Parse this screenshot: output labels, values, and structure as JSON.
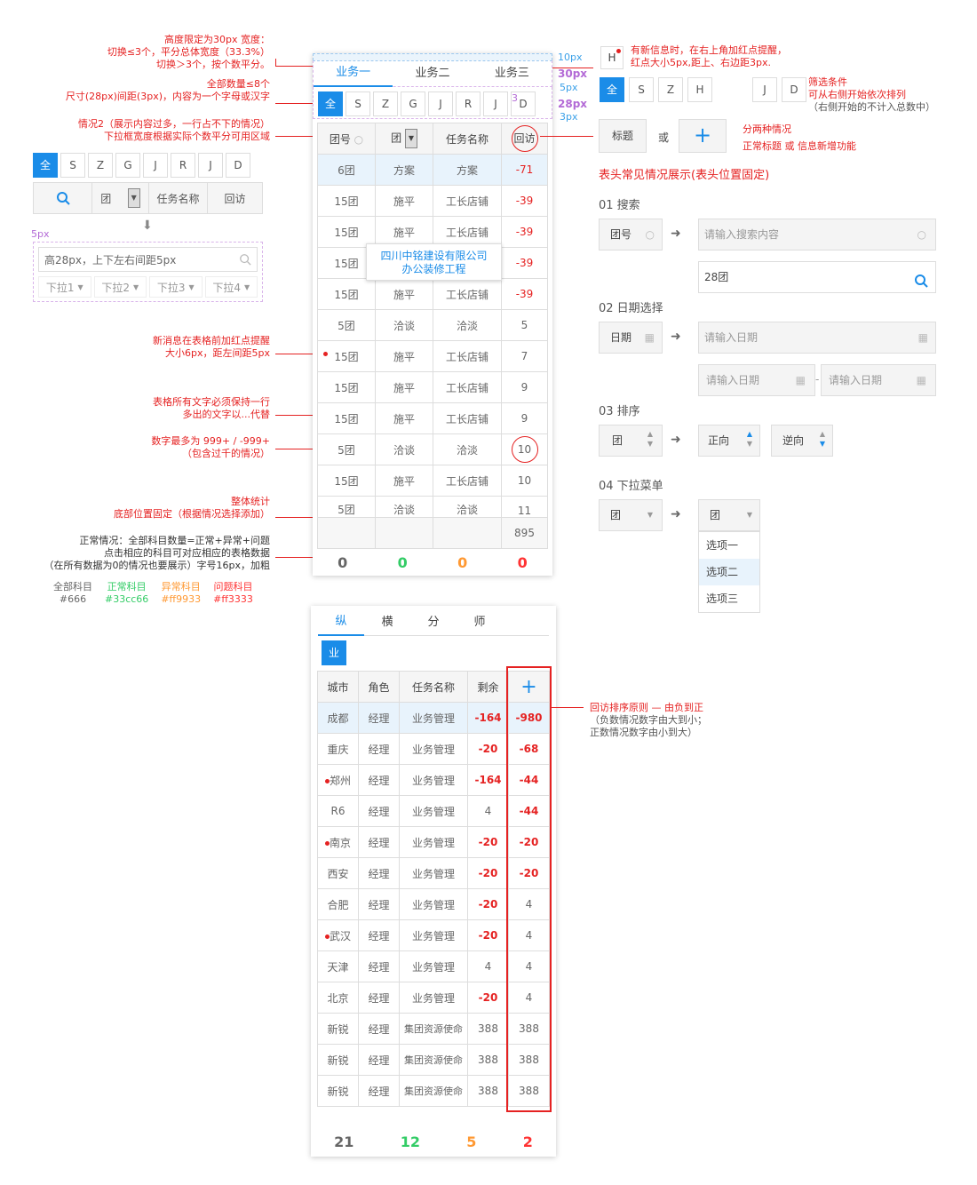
{
  "notes": {
    "n1": [
      "高度限定为30px 宽度：",
      "切换≤3个，平分总体宽度（33.3%）",
      "切换＞3个，按个数平分。"
    ],
    "n2": [
      "全部数量≤8个",
      "尺寸(28px)间距(3px)，内容为一个字母或汉字"
    ],
    "n3": [
      "情况2（展示内容过多，一行占不下的情况）",
      "下拉框宽度根据实际个数平分可用区域"
    ],
    "n4": [
      "新消息在表格前加红点提醒",
      "大小6px，距左间距5px"
    ],
    "n5": [
      "表格所有文字必须保持一行",
      "多出的文字以...代替"
    ],
    "n6": [
      "数字最多为 999+ / -999+",
      "（包含过千的情况）"
    ],
    "n7": [
      "整体统计",
      "底部位置固定（根据情况选择添加）"
    ],
    "n8": [
      "正常情况：全部科目数量=正常+异常+问题",
      "点击相应的科目可对应相应的表格数据",
      "（在所有数据为0的情况也要展示）字号16px，加粗"
    ],
    "legend": [
      {
        "label": "全部科目",
        "hex": "#666"
      },
      {
        "label": "正常科目",
        "hex": "#33cc66"
      },
      {
        "label": "异常科目",
        "hex": "#ff9933"
      },
      {
        "label": "问题科目",
        "hex": "#ff3333"
      }
    ],
    "r1": [
      "有新信息时，在右上角加红点提醒，",
      "红点大小5px,距上、右边距3px."
    ],
    "r2": [
      "筛选条件",
      "可从右侧开始依次排列",
      "（右侧开始的不计入总数中）"
    ],
    "r3": [
      "分两种情况",
      "正常标题 或 信息新增功能"
    ],
    "r4": [
      "回访排序原则 — 由负到正",
      "（负数情况数字由大到小；",
      "正数情况数字由小到大）"
    ],
    "headtitle": "表头常见情况展示(表头位置固定)"
  },
  "dims": {
    "d10": "10px",
    "d30": "30px",
    "d5": "5px",
    "d3a": "3",
    "d28": "28px",
    "d3": "3px",
    "d5b": "5px"
  },
  "panel1": {
    "tabs": [
      "业务一",
      "业务二",
      "业务三"
    ],
    "letters": [
      "全",
      "S",
      "Z",
      "G",
      "J",
      "R",
      "J",
      "D"
    ],
    "headers": [
      "团号",
      "团",
      "任务名称",
      "回访"
    ],
    "rows": [
      [
        "6团",
        "方案",
        "方案",
        "-71"
      ],
      [
        "15团",
        "施平",
        "工长店铺",
        "-39"
      ],
      [
        "15团",
        "施平",
        "工长店铺",
        "-39"
      ],
      [
        "15团",
        "施平",
        "工长店铺",
        "-39"
      ],
      [
        "15团",
        "施平",
        "工长店铺",
        "-39"
      ],
      [
        "5团",
        "洽谈",
        "洽淡",
        "5"
      ],
      [
        "15团",
        "施平",
        "工长店铺",
        "7"
      ],
      [
        "15团",
        "施平",
        "工长店铺",
        "9"
      ],
      [
        "15团",
        "施平",
        "工长店铺",
        "9"
      ],
      [
        "5团",
        "洽谈",
        "洽淡",
        "10"
      ],
      [
        "15团",
        "施平",
        "工长店铺",
        "10"
      ],
      [
        "5团",
        "洽谈",
        "洽谈",
        "11"
      ]
    ],
    "total": "895",
    "sum": [
      "0",
      "0",
      "0",
      "0"
    ],
    "tooltip": [
      "四川中铭建设有限公司",
      "办公装修工程"
    ]
  },
  "left": {
    "letters": [
      "全",
      "S",
      "Z",
      "G",
      "J",
      "R",
      "J",
      "D"
    ],
    "h2": "团",
    "h3": "任务名称",
    "h4": "回访",
    "dim": "5px",
    "search": "高28px，上下左右间距5px",
    "drops": [
      "下拉1",
      "下拉2",
      "下拉3",
      "下拉4"
    ]
  },
  "right": {
    "h": "H",
    "letters": [
      "全",
      "S",
      "Z",
      "H"
    ],
    "jd": [
      "J",
      "D"
    ],
    "title": "标题",
    "or": "或",
    "s1": "01 搜索",
    "s1a": "团号",
    "s1b": "请输入搜索内容",
    "s1c": "28团",
    "s2": "02 日期选择",
    "s2a": "日期",
    "s2b": "请输入日期",
    "s2c": "请输入日期",
    "s2d": "请输入日期",
    "s3": "03 排序",
    "s3a": "团",
    "s3b": "正向",
    "s3c": "逆向",
    "s4": "04 下拉菜单",
    "s4a": "团",
    "s4b": "团",
    "opts": [
      "选项一",
      "选项二",
      "选项三"
    ]
  },
  "panel2": {
    "tabs": [
      "纵",
      "横",
      "分",
      "师"
    ],
    "letter": "业",
    "headers": [
      "城市",
      "角色",
      "任务名称",
      "剩余"
    ],
    "rows": [
      [
        "成都",
        "经理",
        "业务管理",
        "-164",
        "-980"
      ],
      [
        "重庆",
        "经理",
        "业务管理",
        "-20",
        "-68"
      ],
      [
        "郑州",
        "经理",
        "业务管理",
        "-164",
        "-44"
      ],
      [
        "R6",
        "经理",
        "业务管理",
        "4",
        "-44"
      ],
      [
        "南京",
        "经理",
        "业务管理",
        "-20",
        "-20"
      ],
      [
        "西安",
        "经理",
        "业务管理",
        "-20",
        "-20"
      ],
      [
        "合肥",
        "经理",
        "业务管理",
        "-20",
        "4"
      ],
      [
        "武汉",
        "经理",
        "业务管理",
        "-20",
        "4"
      ],
      [
        "天津",
        "经理",
        "业务管理",
        "4",
        "4"
      ],
      [
        "北京",
        "经理",
        "业务管理",
        "-20",
        "4"
      ],
      [
        "新锐",
        "经理",
        "集团资源使命",
        "388",
        "388"
      ],
      [
        "新锐",
        "经理",
        "集团资源使命",
        "388",
        "388"
      ],
      [
        "新锐",
        "经理",
        "集团资源使命",
        "388",
        "388"
      ]
    ],
    "sum": [
      "21",
      "12",
      "5",
      "2"
    ]
  }
}
